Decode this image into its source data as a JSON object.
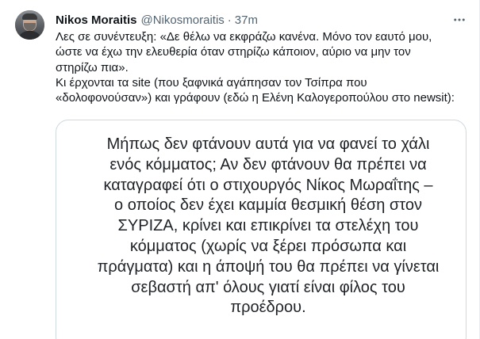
{
  "tweet": {
    "author_name": "Nikos Moraitis",
    "author_handle": "@Nikosmoraitis",
    "separator": "·",
    "timestamp": "37m",
    "more_icon": "more-horizontal-icon",
    "body_lines": [
      "Λες σε συνέντευξη: «Δε θέλω να εκφράζω κανένα. Μόνο τον εαυτό μου,",
      "ώστε να έχω την ελευθερία όταν στηρίζω κάποιον, αύριο να μην τον",
      "στηρίζω πια».",
      "Κι έρχονται τα site (που ξαφνικά αγάπησαν τον Τσίπρα που",
      "«δολοφονούσαν») και γράφουν (εδώ η Ελένη Καλογεροπούλου στο newsit):"
    ]
  },
  "quote": {
    "lines": [
      "Μήπως δεν φτάνουν αυτά για να φανεί το χάλι",
      "ενός κόμματος; Αν δεν φτάνουν θα πρέπει να",
      "καταγραφεί ότι ο στιχουργός Νίκος Μωραΐτης –",
      "ο οποίος δεν έχει καμμία θεσμική θέση στον",
      "ΣΥΡΙΖΑ, κρίνει και  επικρίνει τα στελέχη του",
      "κόμματος (χωρίς να ξέρει πρόσωπα και",
      "πράγματα) και η άποψή του θα πρέπει να γίνεται",
      "σεβαστή απ' όλους γιατί είναι φίλος του",
      "προέδρου."
    ]
  },
  "colors": {
    "text_primary": "#0f1419",
    "text_secondary": "#536471",
    "card_border": "#cfd9de"
  }
}
